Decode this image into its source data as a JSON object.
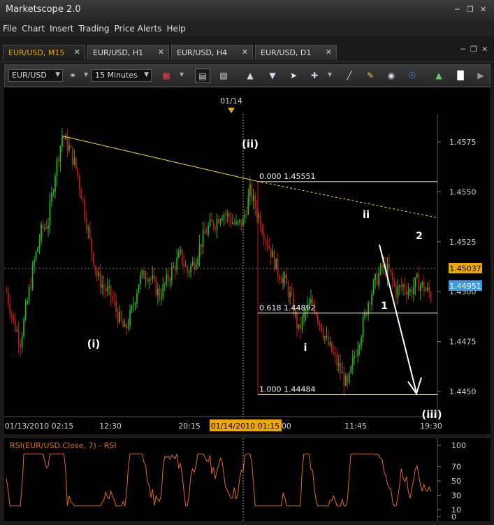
{
  "window": {
    "title": "Marketscope 2.0",
    "minimize_icon": "minimize-icon",
    "restore_icon": "restore-icon",
    "close_icon": "close-icon"
  },
  "menu": [
    "File",
    "Chart",
    "Insert",
    "Trading",
    "Price Alerts",
    "Help"
  ],
  "tabs": [
    {
      "label": "EUR/USD, M15",
      "active": true
    },
    {
      "label": "EUR/USD, H1",
      "active": false
    },
    {
      "label": "EUR/USD, H4",
      "active": false
    },
    {
      "label": "EUR/USD, D1",
      "active": false
    }
  ],
  "toolbar": {
    "instrument": "EUR/USD",
    "timeframe": "15 Minutes",
    "icons": [
      "link-icon",
      "chart-type-icon",
      "bar-style-icon",
      "tick-style-icon",
      "add-indicator-icon",
      "remove-indicator-icon",
      "cursor-icon",
      "crosshair-icon",
      "line-tool-icon",
      "color-tool-icon",
      "eye-icon",
      "globe-icon",
      "picture-icon",
      "text-tool-icon"
    ]
  },
  "chart": {
    "top_date_marker": "01/14",
    "price_axis": [
      "1.4575",
      "1.4550",
      "1.4525",
      "1.4500",
      "1.4475",
      "1.4450"
    ],
    "time_axis": [
      "01/13/2010 02:15",
      "12:30",
      "20:15",
      ":00",
      "11:45",
      "19:30"
    ],
    "crosshair_time": "01/14/2010 01:15",
    "current_price_tag": "1.45037",
    "bid_price_tag": "1.44951",
    "fibonacci": [
      {
        "level": 0.0,
        "price": 1.45551,
        "label": "0.000 1.45551"
      },
      {
        "level": 0.618,
        "price": 1.44892,
        "label": "0.618 1.44892"
      },
      {
        "level": 1.0,
        "price": 1.44484,
        "label": "1.000 1.44484"
      }
    ],
    "wave_labels": [
      "(i)",
      "(ii)",
      "i",
      "ii",
      "1",
      "2",
      "(iii)"
    ],
    "colors": {
      "bull": "#1fb51f",
      "bear": "#c01818",
      "trendline": "#f0e030",
      "fib": "#f2eeb0",
      "current_tag": "#f0a800",
      "bid_tag": "#3a9ce8"
    }
  },
  "chart_data": {
    "type": "candlestick",
    "symbol": "EUR/USD",
    "timeframe": "M15",
    "ylim": [
      1.4438,
      1.4588
    ],
    "price_path": [
      [
        0,
        1.45
      ],
      [
        4,
        1.4485
      ],
      [
        8,
        1.4475
      ],
      [
        12,
        1.4495
      ],
      [
        16,
        1.4515
      ],
      [
        20,
        1.453
      ],
      [
        24,
        1.4535
      ],
      [
        28,
        1.456
      ],
      [
        32,
        1.4578
      ],
      [
        36,
        1.4572
      ],
      [
        40,
        1.4562
      ],
      [
        44,
        1.4545
      ],
      [
        48,
        1.4525
      ],
      [
        52,
        1.4508
      ],
      [
        56,
        1.4502
      ],
      [
        60,
        1.4498
      ],
      [
        64,
        1.4488
      ],
      [
        68,
        1.448
      ],
      [
        72,
        1.449
      ],
      [
        76,
        1.4505
      ],
      [
        80,
        1.451
      ],
      [
        84,
        1.4505
      ],
      [
        88,
        1.4498
      ],
      [
        92,
        1.4505
      ],
      [
        96,
        1.4512
      ],
      [
        100,
        1.4518
      ],
      [
        104,
        1.451
      ],
      [
        108,
        1.4515
      ],
      [
        112,
        1.4525
      ],
      [
        116,
        1.4532
      ],
      [
        120,
        1.4535
      ],
      [
        124,
        1.454
      ],
      [
        128,
        1.4537
      ],
      [
        132,
        1.4533
      ],
      [
        136,
        1.4535
      ],
      [
        140,
        1.455
      ],
      [
        144,
        1.454
      ],
      [
        148,
        1.453
      ],
      [
        152,
        1.452
      ],
      [
        156,
        1.451
      ],
      [
        160,
        1.4505
      ],
      [
        164,
        1.4495
      ],
      [
        168,
        1.448
      ],
      [
        172,
        1.449
      ],
      [
        176,
        1.4495
      ],
      [
        180,
        1.4485
      ],
      [
        184,
        1.4475
      ],
      [
        188,
        1.4468
      ],
      [
        192,
        1.446
      ],
      [
        196,
        1.4452
      ],
      [
        200,
        1.4468
      ],
      [
        204,
        1.448
      ],
      [
        208,
        1.4495
      ],
      [
        212,
        1.4505
      ],
      [
        216,
        1.4512
      ],
      [
        220,
        1.451
      ],
      [
        224,
        1.45
      ],
      [
        228,
        1.4503
      ],
      [
        232,
        1.45
      ],
      [
        236,
        1.4505
      ],
      [
        240,
        1.4502
      ],
      [
        244,
        1.4498
      ]
    ],
    "trendline_points": [
      [
        0,
        1.4578,
        "index 32"
      ],
      [
        1,
        1.4537,
        "right edge"
      ]
    ],
    "rsi": {
      "title": "RSI(EUR/USD.Close, 7) - RSI",
      "levels": [
        "100",
        "70",
        "50",
        "30",
        "10",
        "0"
      ],
      "color": "#e06a10"
    }
  }
}
